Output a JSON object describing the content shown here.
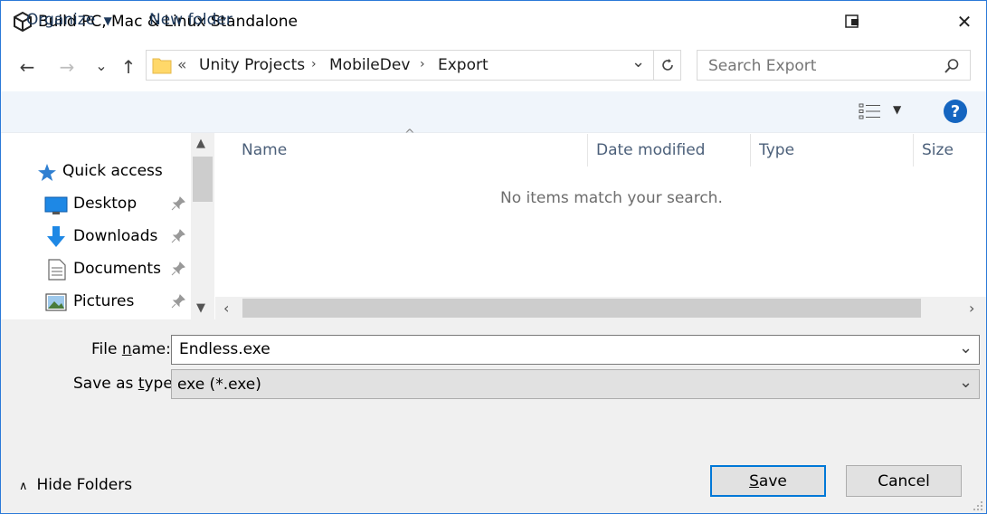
{
  "window": {
    "title": "Build PC, Mac & Linux Standalone",
    "close_glyph": "✕"
  },
  "nav": {
    "back_glyph": "←",
    "forward_glyph": "→",
    "recent_glyph": "⌄",
    "up_glyph": "↑"
  },
  "address": {
    "overflow": "«",
    "crumbs": [
      "Unity Projects",
      "MobileDev",
      "Export"
    ],
    "dropdown_glyph": "⌄"
  },
  "search": {
    "placeholder": "Search Export"
  },
  "toolbar": {
    "organize_label": "Organize",
    "new_folder_label": "New folder",
    "help_glyph": "?"
  },
  "sidebar": {
    "items": [
      {
        "label": "Quick access",
        "icon": "star-icon"
      },
      {
        "label": "Desktop",
        "icon": "desktop-icon"
      },
      {
        "label": "Downloads",
        "icon": "download-icon"
      },
      {
        "label": "Documents",
        "icon": "documents-icon"
      },
      {
        "label": "Pictures",
        "icon": "pictures-icon"
      }
    ]
  },
  "list": {
    "columns": [
      "Name",
      "Date modified",
      "Type",
      "Size"
    ],
    "empty_message": "No items match your search."
  },
  "form": {
    "file_name_label_pre": "File ",
    "file_name_label_u": "n",
    "file_name_label_post": "ame:",
    "file_name_value": "Endless.exe",
    "save_type_label_pre": "Save as ",
    "save_type_label_u": "t",
    "save_type_label_post": "ype:",
    "save_type_value": "exe (*.exe)"
  },
  "footer": {
    "hide_folders_label": "Hide Folders",
    "save_label_u": "S",
    "save_label_rest": "ave",
    "cancel_label": "Cancel"
  },
  "colors": {
    "accent": "#0078d7",
    "toolbar_bg": "#f0f5fb",
    "footer_bg": "#f0f0f0",
    "help_blue": "#1565c0"
  }
}
